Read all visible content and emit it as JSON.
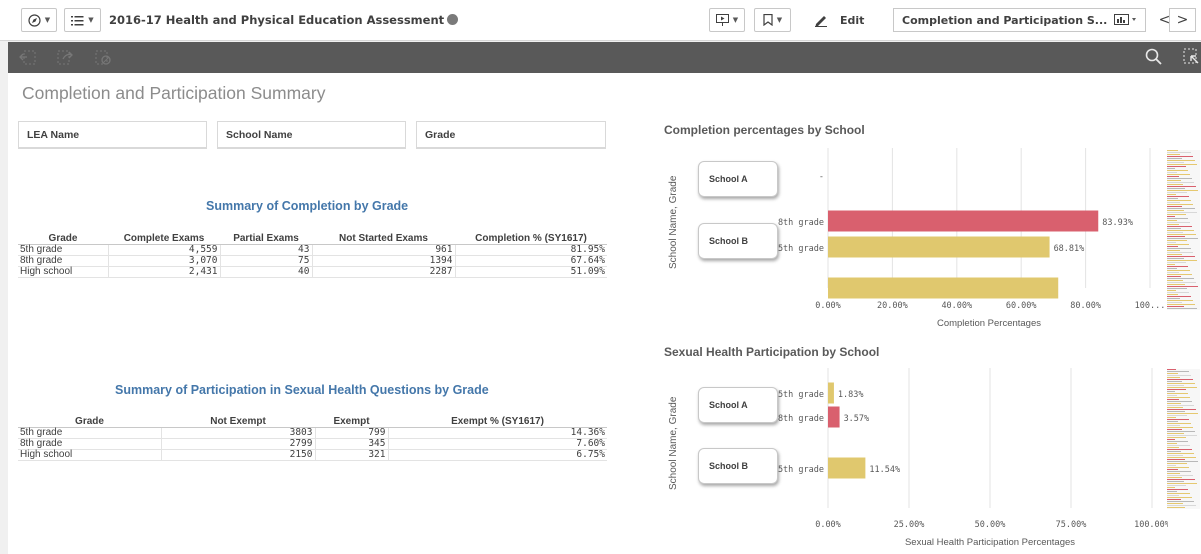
{
  "app_title": "2016-17 Health and Physical Education Assessment",
  "toolbar": {
    "edit_label": "Edit",
    "sheet_name": "Completion and Participation S...",
    "prev_label": "<",
    "next_label": ">"
  },
  "sheet": {
    "title": "Completion and Participation Summary",
    "filters": [
      "LEA Name",
      "School Name",
      "Grade"
    ]
  },
  "completion_table": {
    "title": "Summary of Completion by Grade",
    "headers": [
      "Grade",
      "Complete Exams",
      "Partial Exams",
      "Not Started Exams",
      "Completion % (SY1617)"
    ],
    "rows": [
      [
        "5th grade",
        "4,559",
        "43",
        "961",
        "81.95%"
      ],
      [
        "8th grade",
        "3,070",
        "75",
        "1394",
        "67.64%"
      ],
      [
        "High school",
        "2,431",
        "40",
        "2287",
        "51.09%"
      ]
    ]
  },
  "participation_table": {
    "title": "Summary of Participation in Sexual Health Questions by Grade",
    "headers": [
      "Grade",
      "Not Exempt",
      "Exempt",
      "Exempt % (SY1617)"
    ],
    "rows": [
      [
        "5th grade",
        "3803",
        "799",
        "14.36%"
      ],
      [
        "8th grade",
        "2799",
        "345",
        "7.60%"
      ],
      [
        "High school",
        "2150",
        "321",
        "6.75%"
      ]
    ]
  },
  "chart_data": [
    {
      "type": "bar",
      "orientation": "horizontal",
      "title": "Completion percentages by School",
      "ylabel": "School Name, Grade",
      "xlabel": "Completion Percentages",
      "xticks": [
        "0.00%",
        "20.00%",
        "40.00%",
        "60.00%",
        "80.00%",
        "100..."
      ],
      "xlim": [
        0,
        100
      ],
      "grid": true,
      "groups": [
        {
          "school": "School A",
          "bars": [
            {
              "grade": "-",
              "value": null
            }
          ]
        },
        {
          "school": "School B",
          "bars": [
            {
              "grade": "8th grade",
              "value": 83.93,
              "label": "83.93%",
              "color": "#d9606e"
            },
            {
              "grade": "5th grade",
              "value": 68.81,
              "label": "68.81%",
              "color": "#e0c86e"
            },
            {
              "grade": "",
              "value": 71.5,
              "label": "",
              "color": "#e0c86e"
            }
          ]
        }
      ]
    },
    {
      "type": "bar",
      "orientation": "horizontal",
      "title": "Sexual Health Participation by School",
      "ylabel": "School Name, Grade",
      "xlabel": "Sexual Health Participation Percentages",
      "xticks": [
        "0.00%",
        "25.00%",
        "50.00%",
        "75.00%",
        "100.00%"
      ],
      "xlim": [
        0,
        100
      ],
      "grid": true,
      "groups": [
        {
          "school": "School A",
          "bars": [
            {
              "grade": "5th grade",
              "value": 1.83,
              "label": "1.83%",
              "color": "#e0c86e"
            },
            {
              "grade": "8th grade",
              "value": 3.57,
              "label": "3.57%",
              "color": "#d9606e"
            }
          ]
        },
        {
          "school": "School B",
          "bars": [
            {
              "grade": "5th grade",
              "value": 11.54,
              "label": "11.54%",
              "color": "#e0c86e"
            }
          ]
        }
      ]
    }
  ]
}
